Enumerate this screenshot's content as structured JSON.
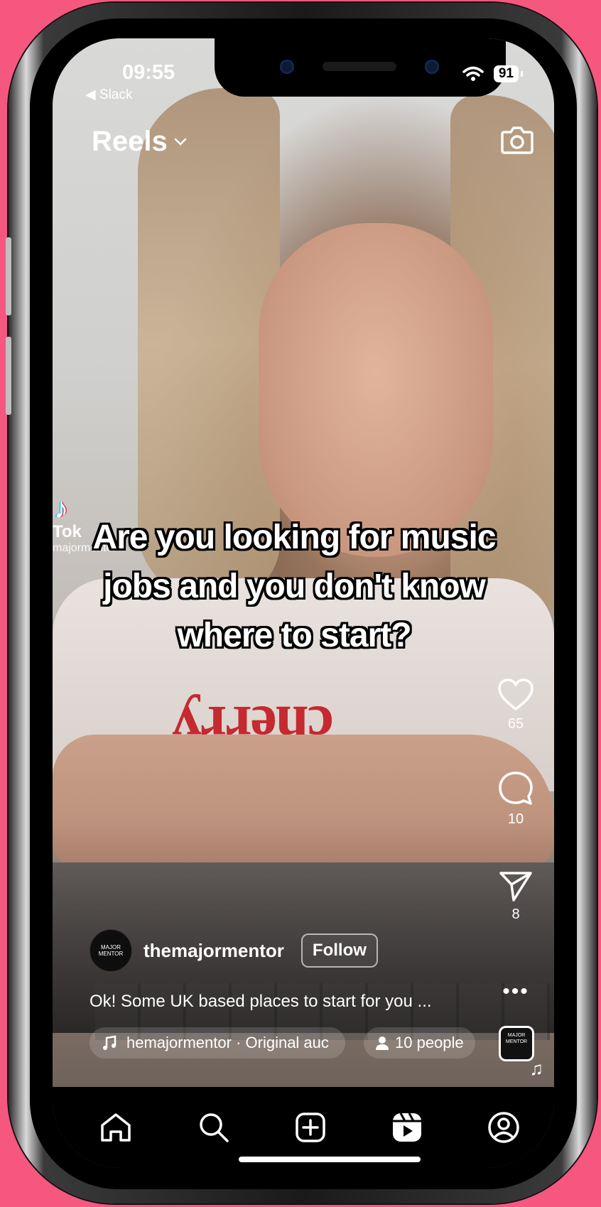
{
  "status_bar": {
    "time": "09:55",
    "back_app": "◀ Slack",
    "battery": "91"
  },
  "header": {
    "title": "Reels"
  },
  "video": {
    "caption": "Are you looking for music jobs and you don't know where to start?",
    "watermark_brand": "Tok",
    "watermark_handle": "majormentor",
    "shirt_text": "cherry"
  },
  "actions": {
    "likes": "65",
    "comments": "10",
    "shares": "8"
  },
  "post": {
    "avatar_label": "MAJOR MENTOR",
    "username": "themajormentor",
    "follow_label": "Follow",
    "description": "Ok! Some UK based places to start for you ...",
    "audio": "hemajormentor · Original auc",
    "people": "10 people",
    "audio_thumb_label": "MAJOR MENTOR"
  },
  "tabs": [
    "home",
    "search",
    "create",
    "reels",
    "profile"
  ],
  "colors": {
    "background": "#f5577f",
    "text": "#ffffff",
    "tabbar": "#000000"
  }
}
